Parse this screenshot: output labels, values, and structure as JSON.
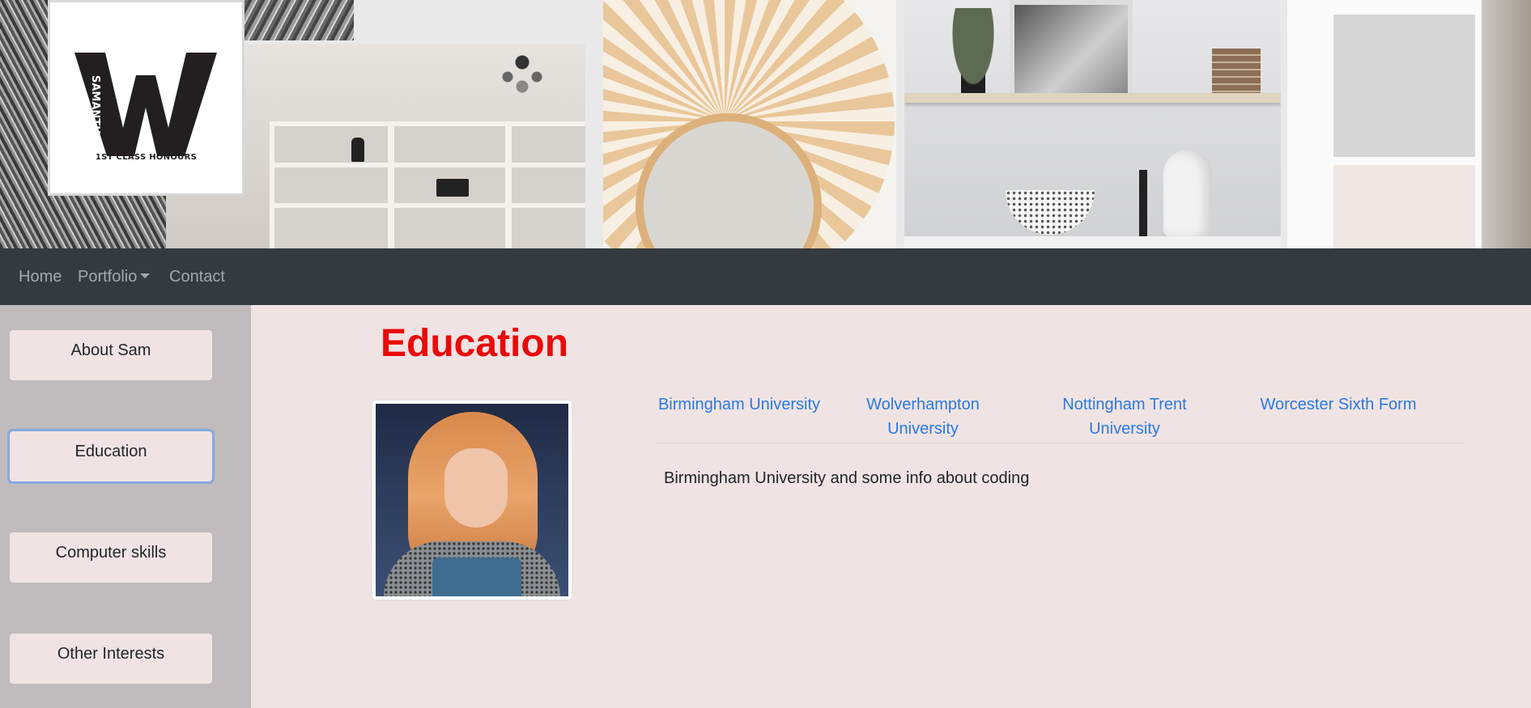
{
  "logo": {
    "letter": "W",
    "side_text": "SAMANTHA",
    "caption": "1ST CLASS HONOURS"
  },
  "navbar": {
    "items": [
      {
        "label": "Home"
      },
      {
        "label": "Portfolio",
        "has_dropdown": true
      },
      {
        "label": "Contact"
      }
    ]
  },
  "sidebar": {
    "items": [
      {
        "label": "About Sam"
      },
      {
        "label": "Education",
        "active": true
      },
      {
        "label": "Computer skills"
      },
      {
        "label": "Other Interests"
      }
    ]
  },
  "main": {
    "title": "Education",
    "tabs": [
      {
        "label": "Birmingham University"
      },
      {
        "label": "Wolverhampton University"
      },
      {
        "label": "Nottingham Trent University"
      },
      {
        "label": "Worcester Sixth Form"
      }
    ],
    "content": "Birmingham University and some info about coding"
  },
  "colors": {
    "navbar": "#343a40",
    "sidebar": "#c0bbbd",
    "background": "#f0e3e3",
    "title": "#ea0a0a",
    "link": "#2a7ae2"
  }
}
